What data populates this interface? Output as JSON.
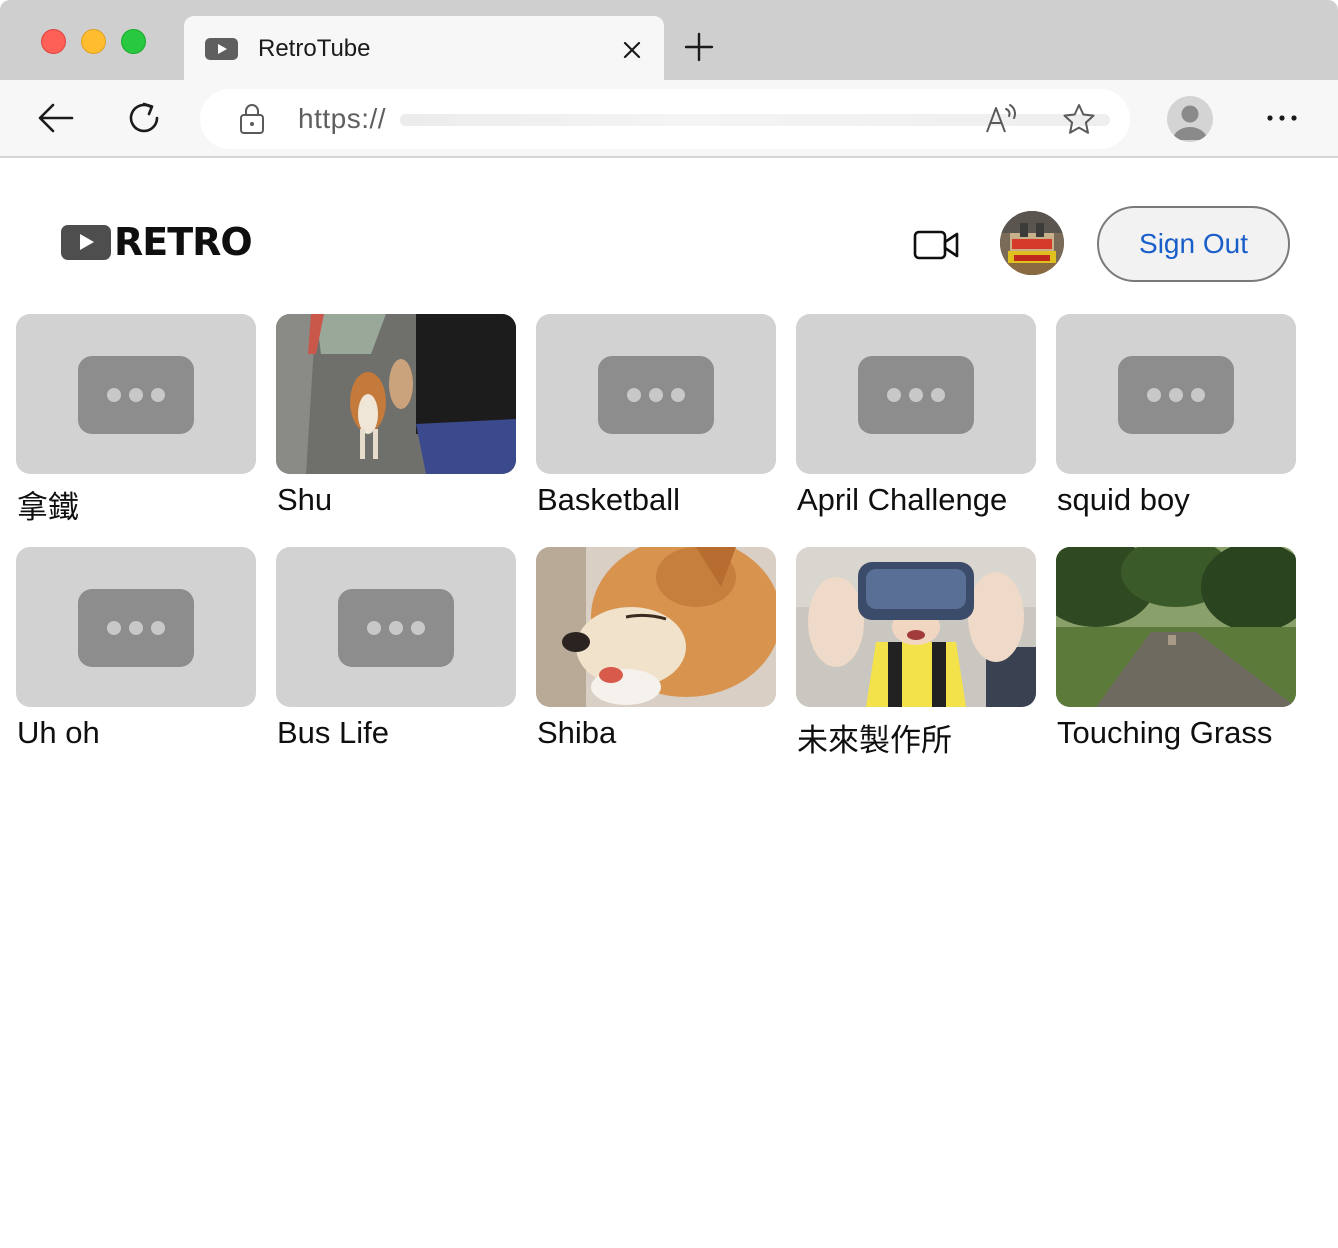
{
  "browser": {
    "tab_title": "RetroTube",
    "url": "https://",
    "tab_icon": "video-icon"
  },
  "header": {
    "logo_text": "RETRO",
    "sign_out_label": "Sign Out",
    "upload_icon": "video-camera-icon"
  },
  "videos": [
    {
      "title": "拿鐵",
      "thumbnail": "placeholder"
    },
    {
      "title": "Shu",
      "thumbnail": "dog-walk-photo"
    },
    {
      "title": "Basketball",
      "thumbnail": "placeholder"
    },
    {
      "title": "April Challenge",
      "thumbnail": "placeholder"
    },
    {
      "title": "squid boy",
      "thumbnail": "placeholder"
    },
    {
      "title": "Uh oh",
      "thumbnail": "placeholder"
    },
    {
      "title": "Bus Life",
      "thumbnail": "placeholder"
    },
    {
      "title": "Shiba",
      "thumbnail": "shiba-dog-photo"
    },
    {
      "title": "未來製作所",
      "thumbnail": "vr-headset-photo"
    },
    {
      "title": "Touching Grass",
      "thumbnail": "park-path-photo"
    }
  ],
  "colors": {
    "sign_out_text": "#1a5fc9",
    "placeholder_bg": "#d2d2d2",
    "placeholder_icon": "#8d8d8d"
  }
}
